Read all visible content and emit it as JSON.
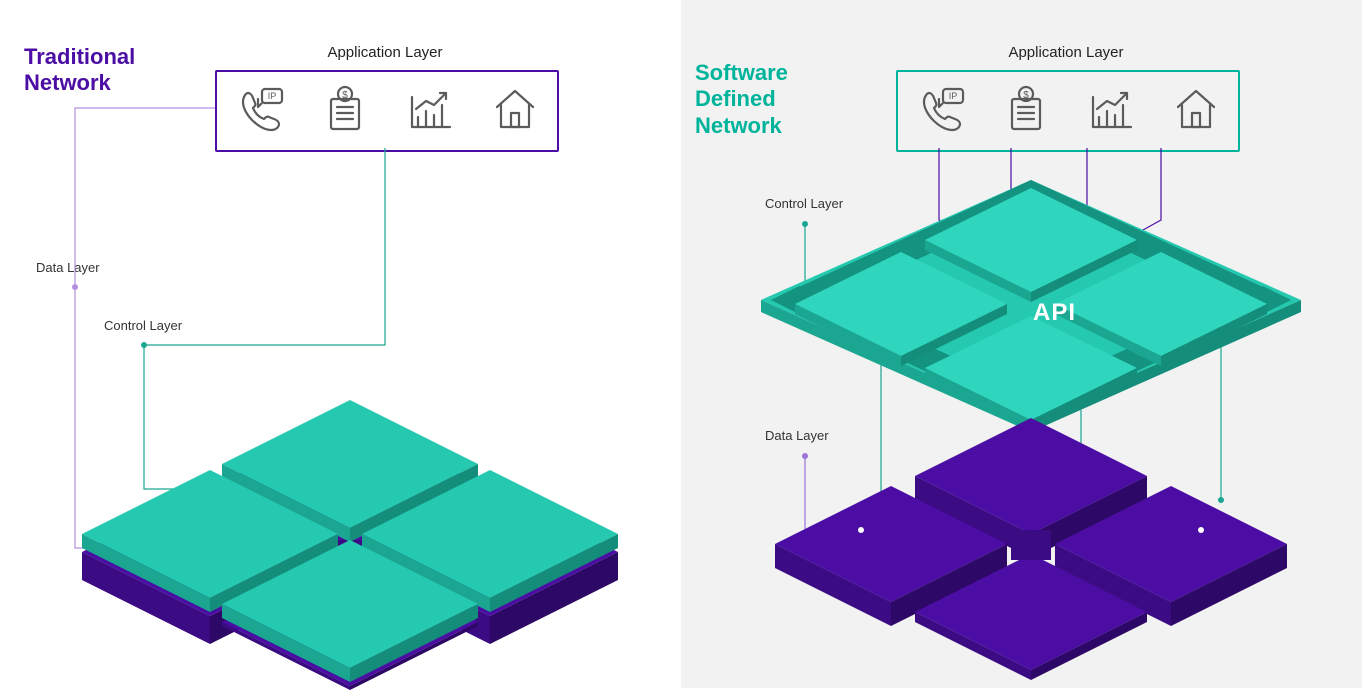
{
  "colors": {
    "purple": "#4b0da3",
    "purple_dark": "#3a0b82",
    "purple_side": "#2d0866",
    "teal": "#25c9b0",
    "teal_dark": "#1aa690",
    "teal_side": "#148e7b",
    "icon": "#5b5b5b",
    "label": "#333333"
  },
  "left": {
    "title_l1": "Traditional",
    "title_l2": "Network",
    "app_layer_label": "Application Layer",
    "data_layer_label": "Data Layer",
    "control_layer_label": "Control Layer"
  },
  "right": {
    "title_l1": "Software",
    "title_l2": "Defined",
    "title_l3": "Network",
    "app_layer_label": "Application Layer",
    "control_layer_label": "Control Layer",
    "data_layer_label": "Data Layer",
    "api_label": "API"
  },
  "icons": [
    {
      "name": "voip-phone-icon",
      "tag": "IP"
    },
    {
      "name": "dollar-doc-icon"
    },
    {
      "name": "analytics-chart-icon"
    },
    {
      "name": "house-icon"
    }
  ]
}
